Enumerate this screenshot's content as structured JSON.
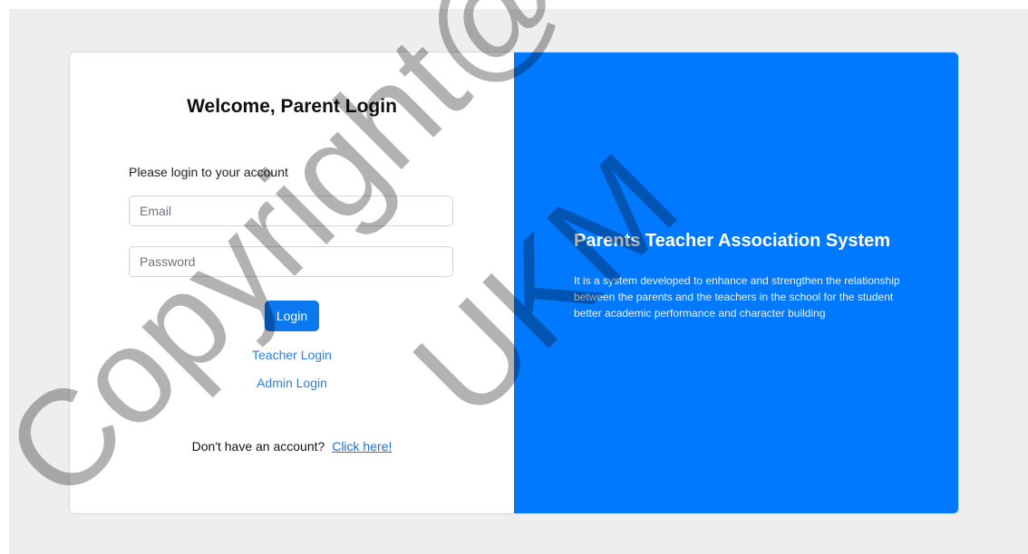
{
  "login": {
    "title": "Welcome, Parent Login",
    "prompt": "Please login to your account",
    "email_placeholder": "Email",
    "password_placeholder": "Password",
    "login_button": "Login",
    "teacher_link": "Teacher Login",
    "admin_link": "Admin Login",
    "signup_text": "Don't have an account?",
    "signup_link": "Click here!"
  },
  "info": {
    "title": "Parents Teacher Association System",
    "description": "It is a system developed to enhance and strengthen the relationship between the parents and the teachers in the school for the student better academic performance and character building"
  },
  "watermark": {
    "text1": "Copyright@",
    "text2": "UKM"
  },
  "colors": {
    "accent": "#0079ff",
    "button": "#0b78f0",
    "link": "#2f7de0",
    "page_bg": "#eeeeee"
  }
}
